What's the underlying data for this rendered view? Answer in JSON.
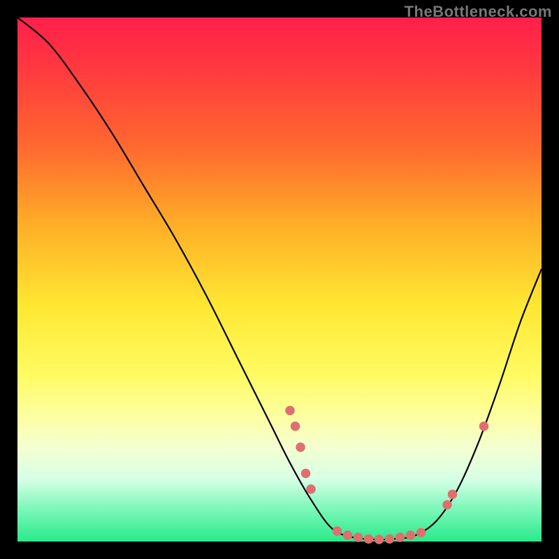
{
  "attribution": "TheBottleneck.com",
  "chart_data": {
    "type": "line",
    "title": "",
    "xlabel": "",
    "ylabel": "",
    "xlim": [
      0,
      100
    ],
    "ylim": [
      0,
      100
    ],
    "curve": [
      {
        "x": 0,
        "y": 100
      },
      {
        "x": 6,
        "y": 95
      },
      {
        "x": 12,
        "y": 87
      },
      {
        "x": 18,
        "y": 78
      },
      {
        "x": 24,
        "y": 68
      },
      {
        "x": 30,
        "y": 58
      },
      {
        "x": 36,
        "y": 47
      },
      {
        "x": 42,
        "y": 35
      },
      {
        "x": 48,
        "y": 23
      },
      {
        "x": 52,
        "y": 15
      },
      {
        "x": 56,
        "y": 8
      },
      {
        "x": 60,
        "y": 2.5
      },
      {
        "x": 64,
        "y": 0.8
      },
      {
        "x": 68,
        "y": 0.4
      },
      {
        "x": 72,
        "y": 0.5
      },
      {
        "x": 76,
        "y": 1.2
      },
      {
        "x": 80,
        "y": 4
      },
      {
        "x": 84,
        "y": 10
      },
      {
        "x": 88,
        "y": 19
      },
      {
        "x": 92,
        "y": 30
      },
      {
        "x": 96,
        "y": 42
      },
      {
        "x": 100,
        "y": 52
      }
    ],
    "markers": [
      {
        "x": 52,
        "y": 25
      },
      {
        "x": 53,
        "y": 22
      },
      {
        "x": 54,
        "y": 18
      },
      {
        "x": 55,
        "y": 13
      },
      {
        "x": 56,
        "y": 10
      },
      {
        "x": 61,
        "y": 2
      },
      {
        "x": 63,
        "y": 1.2
      },
      {
        "x": 65,
        "y": 0.8
      },
      {
        "x": 67,
        "y": 0.5
      },
      {
        "x": 69,
        "y": 0.4
      },
      {
        "x": 71,
        "y": 0.5
      },
      {
        "x": 73,
        "y": 0.8
      },
      {
        "x": 75,
        "y": 1.2
      },
      {
        "x": 77,
        "y": 1.7
      },
      {
        "x": 82,
        "y": 7
      },
      {
        "x": 83,
        "y": 9
      },
      {
        "x": 89,
        "y": 22
      }
    ]
  }
}
